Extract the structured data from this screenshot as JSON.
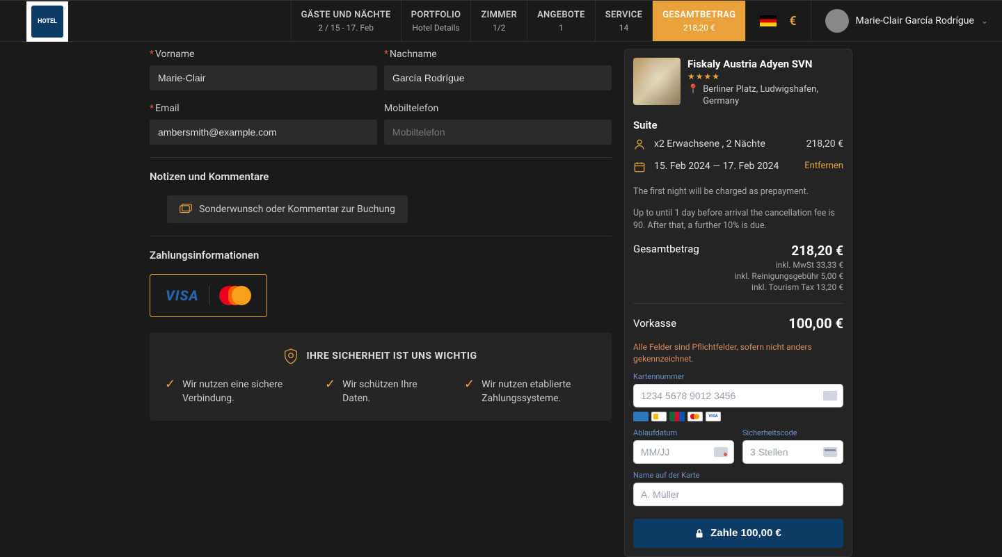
{
  "header": {
    "tabs": [
      {
        "label": "GÄSTE UND NÄCHTE",
        "sub": "2 / 15 - 17. Feb"
      },
      {
        "label": "PORTFOLIO",
        "sub": "Hotel Details"
      },
      {
        "label": "ZIMMER",
        "sub": "1/2"
      },
      {
        "label": "ANGEBOTE",
        "sub": "1"
      },
      {
        "label": "SERVICE",
        "sub": "14"
      },
      {
        "label": "GESAMTBETRAG",
        "sub": "218,20 €"
      }
    ],
    "currency_symbol": "€",
    "user_name": "Marie-Clair García Rodrígue"
  },
  "form": {
    "firstname_label": "Vorname",
    "firstname_value": "Marie-Clair",
    "lastname_label": "Nachname",
    "lastname_value": "García Rodrígue",
    "email_label": "Email",
    "email_value": "ambersmith@example.com",
    "mobile_label": "Mobiltelefon",
    "mobile_placeholder": "Mobiltelefon",
    "notes_title": "Notizen und Kommentare",
    "comment_button": "Sonderwunsch oder Kommentar zur Buchung",
    "payment_title": "Zahlungsinformationen"
  },
  "security": {
    "title": "IHRE SICHERHEIT IST UNS WICHTIG",
    "items": [
      "Wir nutzen eine sichere Verbindung.",
      "Wir schützen Ihre Daten.",
      "Wir nutzen etablierte Zahlungssysteme."
    ]
  },
  "summary": {
    "hotel_name": "Fiskaly Austria Adyen SVN",
    "stars": "★★★★",
    "location": "Berliner Platz, Ludwigshafen, Germany",
    "room_type": "Suite",
    "guests_line": "x2 Erwachsene , 2 Nächte",
    "guests_price": "218,20 €",
    "dates_line": "15. Feb 2024 — 17. Feb 2024",
    "remove": "Entfernen",
    "policy1": "The first night will be charged as prepayment.",
    "policy2": "Up to until 1 day before arrival the cancellation fee is 90. After that, a further 10% is due.",
    "total_label": "Gesamtbetrag",
    "total_amount": "218,20 €",
    "taxes": [
      "inkl. MwSt 33,33 €",
      "inkl. Reinigungsgebühr 5,00 €",
      "inkl. Tourism Tax 13,20 €"
    ],
    "prepay_label": "Vorkasse",
    "prepay_amount": "100,00 €"
  },
  "payment": {
    "required_hint": "Alle Felder sind Pflichtfelder, sofern nicht anders gekennzeichnet.",
    "card_number_label": "Kartennummer",
    "card_number_placeholder": "1234 5678 9012 3456",
    "expiry_label": "Ablaufdatum",
    "expiry_placeholder": "MM/JJ",
    "cvc_label": "Sicherheitscode",
    "cvc_placeholder": "3 Stellen",
    "name_label": "Name auf der Karte",
    "name_placeholder": "A. Müller",
    "pay_button": "Zahle 100,00 €"
  }
}
